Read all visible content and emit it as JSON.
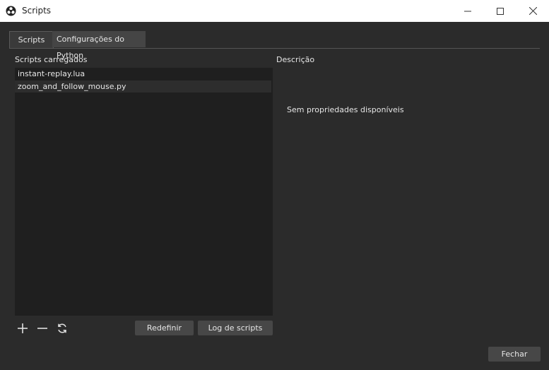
{
  "window": {
    "title": "Scripts"
  },
  "tabs": [
    {
      "label": "Scripts"
    },
    {
      "label": "Configurações do Python"
    }
  ],
  "left_panel": {
    "heading": "Scripts carregados",
    "scripts": [
      {
        "name": "instant-replay.lua"
      },
      {
        "name": "zoom_and_follow_mouse.py"
      }
    ]
  },
  "right_panel": {
    "heading": "Descrição",
    "empty_message": "Sem propriedades disponíveis"
  },
  "toolbar": {
    "icons": [
      "plus-icon",
      "minus-icon",
      "refresh-icon"
    ],
    "reset_label": "Redefinir",
    "log_label": "Log de scripts"
  },
  "footer": {
    "close_label": "Fechar"
  },
  "colors": {
    "background": "#2b2b2b",
    "list_background": "#1f1f1f",
    "button": "#474747",
    "titlebar": "#ffffff"
  }
}
